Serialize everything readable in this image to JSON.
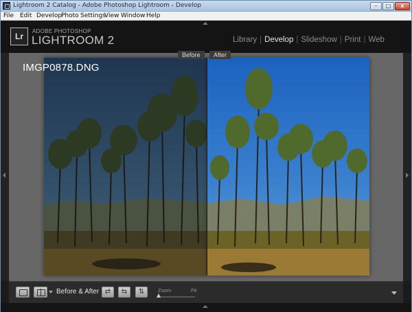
{
  "window": {
    "title": "Lightroom 2 Catalog - Adobe Photoshop Lightroom - Develop",
    "min_glyph": "–",
    "max_glyph": "□",
    "close_glyph": "x"
  },
  "menu": {
    "items": [
      "File",
      "Edit",
      "Develop",
      "Photo",
      "Settings",
      "View",
      "Window",
      "Help"
    ]
  },
  "brand": {
    "logo": "Lr",
    "line1": "ADOBE PHOTOSHOP",
    "line2": "LIGHTROOM 2"
  },
  "modules": {
    "library": "Library",
    "develop": "Develop",
    "slideshow": "Slideshow",
    "print": "Print",
    "web": "Web",
    "separator": "|",
    "active": "Develop"
  },
  "viewer": {
    "filename": "IMGP0878.DNG",
    "before_label": "Before",
    "after_label": "After"
  },
  "toolbar": {
    "before_after_label": "Before & After :",
    "copy_right_glyph": "⇄",
    "copy_left_glyph": "⇆",
    "swap_glyph": "⇅",
    "zoom_label": "Zoom",
    "fit_label": "Fit"
  },
  "colors": {
    "before_sky": "#2d4660",
    "after_sky": "#2f6fb8",
    "panel_bg": "#676767",
    "active_module": "#e8e8e8"
  }
}
